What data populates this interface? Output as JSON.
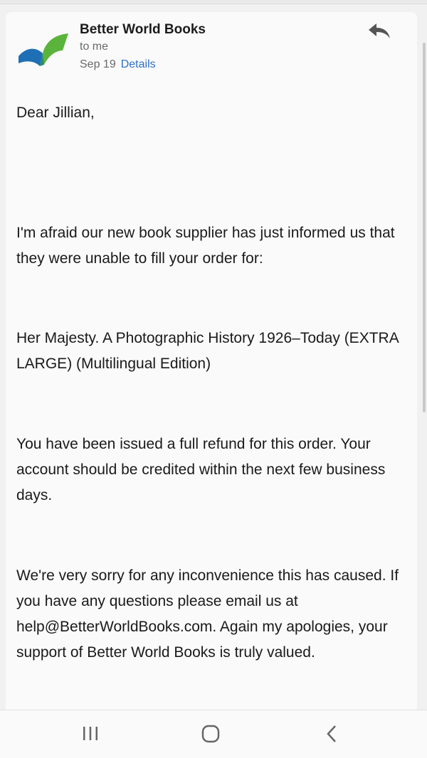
{
  "email": {
    "sender": "Better World Books",
    "recipient": "to me",
    "date": "Sep 19",
    "details_link": "Details",
    "greeting": "Dear Jillian,",
    "paragraph1": "I'm afraid our new book supplier has just informed us that they were unable to fill your order for:",
    "book_title": "Her Majesty. A Photographic History 1926–Today (EXTRA LARGE) (Multilingual Edition)",
    "paragraph2": "You have been issued a full refund for this order. Your account should be credited within the next few business days.",
    "paragraph3": "We're very sorry for any inconvenience this has caused. If you have any questions please email us at help@BetterWorldBooks.com. Again my apologies, your support of Better World Books is truly valued."
  },
  "icons": {
    "logo": "book-logo-icon",
    "reply": "reply-icon",
    "recents": "recent-apps-icon",
    "home": "home-icon",
    "back": "back-icon"
  },
  "colors": {
    "link": "#2f6fc5",
    "logo_blue": "#1f6fb6",
    "logo_green": "#5ab43c"
  }
}
